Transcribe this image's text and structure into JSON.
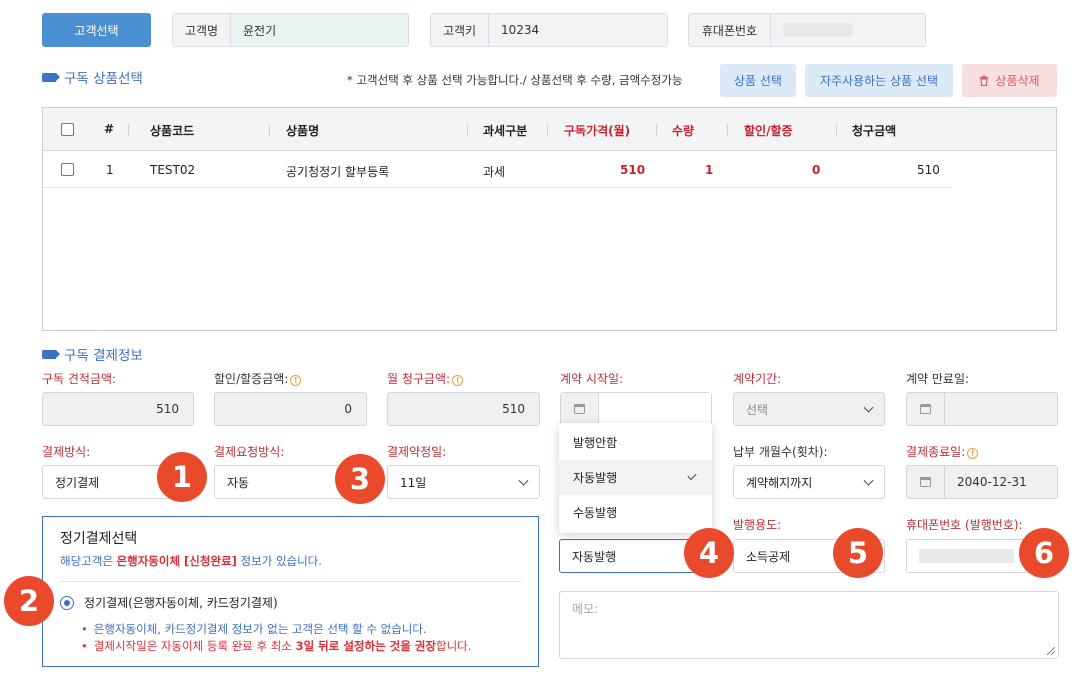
{
  "top": {
    "select_customer": "고객선택",
    "customer_name_label": "고객명",
    "customer_name_value": "윤전기",
    "customer_key_label": "고객키",
    "customer_key_value": "10234",
    "phone_label": "휴대폰번호"
  },
  "products": {
    "title": "구독 상품선택",
    "notice": "* 고객선택 후 상품 선택 가능합니다./ 상품선택 후 수량, 금액수정가능",
    "select_product": "상품 선택",
    "frequent_product": "자주사용하는 상품 선택",
    "delete_product": "상품삭제",
    "columns": [
      "#",
      "상품코드",
      "상품명",
      "과세구분",
      "구독가격(월)",
      "수량",
      "할인/할증",
      "청구금액"
    ],
    "rows": [
      {
        "no": "1",
        "code": "TEST02",
        "name": "공기청정기 할부등록",
        "tax": "과세",
        "price": "510",
        "qty": "1",
        "discount": "0",
        "amount": "510"
      }
    ]
  },
  "payment": {
    "title": "구독 결제정보",
    "quote_label": "구독 견적금액:",
    "quote_value": "510",
    "discount_label": "할인/할증금액:",
    "discount_value": "0",
    "monthly_label": "월 청구금액:",
    "monthly_value": "510",
    "start_label": "계약 시작일:",
    "period_label": "계약기간:",
    "period_value": "선택",
    "end_label": "계약 만료일:",
    "method_label": "결제방식:",
    "method_value": "정기결제",
    "request_label": "결제요청방식:",
    "request_value": "자동",
    "day_label": "결제약정일:",
    "day_value": "11일",
    "months_label": "납부 개월수(횟차):",
    "months_value": "계약해지까지",
    "pay_end_label": "결제종료일:",
    "pay_end_value": "2040-12-31",
    "issue_purpose_label": "발행용도:",
    "issue_purpose_value": "소득공제",
    "issue_phone_label": "휴대폰번호 (발행번호):",
    "issue_value": "자동발행",
    "memo_placeholder": "메모:"
  },
  "dropdown": {
    "options": [
      "발행안함",
      "자동발행",
      "수동발행"
    ],
    "selected": "자동발행"
  },
  "regular": {
    "title": "정기결제선택",
    "info_pre": "해당고객은 ",
    "info_bold": "은행자동이체 [신청완료]",
    "info_post": " 정보가 있습니다.",
    "radio_label": "정기결제(은행자동이체, 카드정기결제)",
    "bullet1": "은행자동이체, 카드정기결제 정보가 없는 고객은 선택 할 수 없습니다.",
    "bullet2_pre": "결제시작일은 자동이체 등록 완료 후 최소 ",
    "bullet2_bold": "3일 뒤로 설정하는 것을 권장",
    "bullet2_post": "합니다."
  },
  "badges": [
    "1",
    "2",
    "3",
    "4",
    "5",
    "6"
  ],
  "colors": {
    "accent": "#4a90d2",
    "title_blue": "#3c71c4",
    "required_red": "#b8303a",
    "badge": "#e94a2c"
  }
}
